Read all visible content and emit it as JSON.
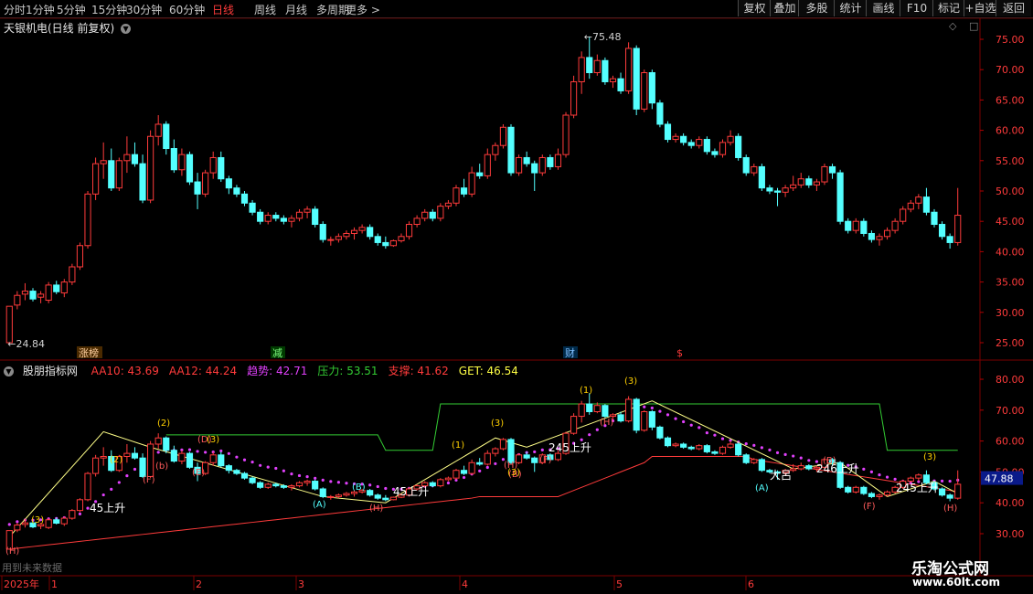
{
  "toolbar": {
    "periods": [
      "分时",
      "1分钟",
      "5分钟",
      "15分钟",
      "30分钟",
      "60分钟",
      "日线",
      "周线",
      "月线",
      "多周期",
      "更多 >"
    ],
    "active_period": "日线",
    "right_buttons": [
      "复权",
      "叠加",
      "多股",
      "统计",
      "画线",
      "F10",
      "标记",
      "+自选",
      "返回"
    ]
  },
  "main_chart": {
    "title": "天银机电(日线 前复权)",
    "high_label": "75.48",
    "low_label": "24.84",
    "price_axis": [
      "75.00",
      "70.00",
      "65.00",
      "60.00",
      "55.00",
      "50.00",
      "45.00",
      "40.00",
      "35.00",
      "30.00",
      "25.00"
    ],
    "event_tags": [
      "涨榜",
      "减",
      "财",
      "$"
    ],
    "candles": [
      [
        25.0,
        31.0,
        24.84,
        31.0
      ],
      [
        31.2,
        33.5,
        30.5,
        32.8
      ],
      [
        33.0,
        34.8,
        32.0,
        33.5
      ],
      [
        33.5,
        34.0,
        31.8,
        32.2
      ],
      [
        32.5,
        33.5,
        31.5,
        33.0
      ],
      [
        32.0,
        35.0,
        31.5,
        34.5
      ],
      [
        34.5,
        35.2,
        33.0,
        33.4
      ],
      [
        33.2,
        35.5,
        32.5,
        35.0
      ],
      [
        35.0,
        38.0,
        34.5,
        37.5
      ],
      [
        37.5,
        41.5,
        37.0,
        41.0
      ],
      [
        41.0,
        50.0,
        40.5,
        49.5
      ],
      [
        49.5,
        55.5,
        48.5,
        54.5
      ],
      [
        54.5,
        58.0,
        52.0,
        55.0
      ],
      [
        55.0,
        57.0,
        50.0,
        50.5
      ],
      [
        50.5,
        55.5,
        50.0,
        55.0
      ],
      [
        55.0,
        59.0,
        53.0,
        56.0
      ],
      [
        56.0,
        58.0,
        54.0,
        54.5
      ],
      [
        54.5,
        56.0,
        48.0,
        48.5
      ],
      [
        48.5,
        60.0,
        48.0,
        59.0
      ],
      [
        59.0,
        62.5,
        57.5,
        61.0
      ],
      [
        61.0,
        61.5,
        56.0,
        57.0
      ],
      [
        57.0,
        58.5,
        53.0,
        53.5
      ],
      [
        53.5,
        57.0,
        52.5,
        56.0
      ],
      [
        56.0,
        56.5,
        51.0,
        51.5
      ],
      [
        51.5,
        53.0,
        47.0,
        49.5
      ],
      [
        49.5,
        53.5,
        49.0,
        53.0
      ],
      [
        53.0,
        56.5,
        52.0,
        55.5
      ],
      [
        55.5,
        56.5,
        51.5,
        52.0
      ],
      [
        52.0,
        52.5,
        49.5,
        50.5
      ],
      [
        50.5,
        51.0,
        49.0,
        49.5
      ],
      [
        49.5,
        50.0,
        47.5,
        48.0
      ],
      [
        48.0,
        48.5,
        46.0,
        46.5
      ],
      [
        46.5,
        47.0,
        44.5,
        45.0
      ],
      [
        45.0,
        46.5,
        44.5,
        46.0
      ],
      [
        46.0,
        46.5,
        45.0,
        45.5
      ],
      [
        45.5,
        46.0,
        44.5,
        45.0
      ],
      [
        45.0,
        46.0,
        44.0,
        45.5
      ],
      [
        45.5,
        47.0,
        45.0,
        46.5
      ],
      [
        46.5,
        47.5,
        45.5,
        47.0
      ],
      [
        47.0,
        47.5,
        44.0,
        44.5
      ],
      [
        44.5,
        45.0,
        41.5,
        42.0
      ],
      [
        42.0,
        42.5,
        41.0,
        42.0
      ],
      [
        42.0,
        43.0,
        41.5,
        42.5
      ],
      [
        42.5,
        43.5,
        42.0,
        43.0
      ],
      [
        43.0,
        44.0,
        42.0,
        43.5
      ],
      [
        43.5,
        44.5,
        43.0,
        44.0
      ],
      [
        44.0,
        44.5,
        42.0,
        42.5
      ],
      [
        42.5,
        43.0,
        41.0,
        41.5
      ],
      [
        41.5,
        42.5,
        40.5,
        41.0
      ],
      [
        41.0,
        42.0,
        40.8,
        41.8
      ],
      [
        41.8,
        43.0,
        41.5,
        42.5
      ],
      [
        42.5,
        45.0,
        42.0,
        44.5
      ],
      [
        44.5,
        46.0,
        44.0,
        45.5
      ],
      [
        45.5,
        47.0,
        45.0,
        46.5
      ],
      [
        46.5,
        47.0,
        45.0,
        45.5
      ],
      [
        45.5,
        48.0,
        45.0,
        47.5
      ],
      [
        47.5,
        48.5,
        47.0,
        48.0
      ],
      [
        48.0,
        51.0,
        47.5,
        50.5
      ],
      [
        50.5,
        52.0,
        49.0,
        49.5
      ],
      [
        49.5,
        54.0,
        49.0,
        53.0
      ],
      [
        53.0,
        54.5,
        52.0,
        52.5
      ],
      [
        52.5,
        57.0,
        52.0,
        56.0
      ],
      [
        56.0,
        58.0,
        55.0,
        57.5
      ],
      [
        57.5,
        61.0,
        57.0,
        60.5
      ],
      [
        60.5,
        61.0,
        52.5,
        53.0
      ],
      [
        53.0,
        56.0,
        52.5,
        55.5
      ],
      [
        55.5,
        56.5,
        54.0,
        54.5
      ],
      [
        54.5,
        55.0,
        50.0,
        53.0
      ],
      [
        53.0,
        56.0,
        52.5,
        55.5
      ],
      [
        55.5,
        56.0,
        53.5,
        54.0
      ],
      [
        54.0,
        57.0,
        53.5,
        56.0
      ],
      [
        56.0,
        63.0,
        55.5,
        62.5
      ],
      [
        62.5,
        69.0,
        62.0,
        68.0
      ],
      [
        68.0,
        73.0,
        66.0,
        72.0
      ],
      [
        72.0,
        75.48,
        68.5,
        69.5
      ],
      [
        69.5,
        72.5,
        69.0,
        71.5
      ],
      [
        71.5,
        72.0,
        67.5,
        68.0
      ],
      [
        68.0,
        69.0,
        67.0,
        68.5
      ],
      [
        68.5,
        69.5,
        66.0,
        66.5
      ],
      [
        66.5,
        74.5,
        66.0,
        73.5
      ],
      [
        73.5,
        74.0,
        62.5,
        63.5
      ],
      [
        63.5,
        70.0,
        63.0,
        69.5
      ],
      [
        69.5,
        70.0,
        63.5,
        64.5
      ],
      [
        64.5,
        65.0,
        60.5,
        61.0
      ],
      [
        61.0,
        61.5,
        58.0,
        58.5
      ],
      [
        58.5,
        59.5,
        58.0,
        59.0
      ],
      [
        59.0,
        59.5,
        57.5,
        58.0
      ],
      [
        58.0,
        58.5,
        57.0,
        57.5
      ],
      [
        57.5,
        59.0,
        57.0,
        58.5
      ],
      [
        58.5,
        59.0,
        56.0,
        56.5
      ],
      [
        56.5,
        57.0,
        55.5,
        56.0
      ],
      [
        56.0,
        58.5,
        55.5,
        58.0
      ],
      [
        58.0,
        60.0,
        57.5,
        59.0
      ],
      [
        59.0,
        59.5,
        55.0,
        55.5
      ],
      [
        55.5,
        56.0,
        52.5,
        53.0
      ],
      [
        53.0,
        54.5,
        52.5,
        54.0
      ],
      [
        54.0,
        54.5,
        50.0,
        50.5
      ],
      [
        50.5,
        51.0,
        49.5,
        50.0
      ],
      [
        50.0,
        50.5,
        47.5,
        49.8
      ],
      [
        49.8,
        51.0,
        49.0,
        50.5
      ],
      [
        50.5,
        52.5,
        50.0,
        51.0
      ],
      [
        51.0,
        53.0,
        50.5,
        52.0
      ],
      [
        52.0,
        52.5,
        50.5,
        51.0
      ],
      [
        51.0,
        52.0,
        50.0,
        51.5
      ],
      [
        51.5,
        54.5,
        51.0,
        54.0
      ],
      [
        54.0,
        54.5,
        52.0,
        53.0
      ],
      [
        53.0,
        53.5,
        44.5,
        45.0
      ],
      [
        45.0,
        45.5,
        43.0,
        43.5
      ],
      [
        43.5,
        45.5,
        43.0,
        45.0
      ],
      [
        45.0,
        45.5,
        42.5,
        43.0
      ],
      [
        43.0,
        43.5,
        41.5,
        42.0
      ],
      [
        42.0,
        43.0,
        41.0,
        42.5
      ],
      [
        42.5,
        44.0,
        42.0,
        43.5
      ],
      [
        43.5,
        45.5,
        43.0,
        45.0
      ],
      [
        45.0,
        47.5,
        44.5,
        47.0
      ],
      [
        47.0,
        48.5,
        46.5,
        48.0
      ],
      [
        48.0,
        49.5,
        47.0,
        49.0
      ],
      [
        49.0,
        50.5,
        46.0,
        46.5
      ],
      [
        46.5,
        47.0,
        44.0,
        44.5
      ],
      [
        44.5,
        45.0,
        42.0,
        42.5
      ],
      [
        42.5,
        43.0,
        40.5,
        41.5
      ],
      [
        41.5,
        50.5,
        41.0,
        46.0
      ]
    ]
  },
  "indicator": {
    "name": "股朋指标网",
    "legend": [
      {
        "label": "AA10: 43.69",
        "color": "#ff3b3b"
      },
      {
        "label": "AA12: 44.24",
        "color": "#ff3b3b"
      },
      {
        "label": "趋势: 42.71",
        "color": "#e040fb"
      },
      {
        "label": "压力: 53.51",
        "color": "#33cc33"
      },
      {
        "label": "支撑: 41.62",
        "color": "#ff3b3b"
      },
      {
        "label": "GET: 46.54",
        "color": "#ffff44"
      }
    ],
    "axis": [
      "80.00",
      "70.00",
      "60.00",
      "50.00",
      "40.00",
      "30.00"
    ],
    "current_value": "47.88",
    "annotations": [
      "45上升",
      "45上升",
      "245上升",
      "大呂",
      "246上升",
      "245上升",
      "(A)",
      "(A)",
      "(B)",
      "(B)",
      "(E)",
      "(F)",
      "(F)",
      "(H)",
      "(H)",
      "(H)",
      "(H)",
      "(H)",
      "(B)",
      "(F)",
      "(D)",
      "(b)",
      "(2)",
      "(1)",
      "(1)",
      "(2)",
      "(3)",
      "(3)",
      "(3)",
      "(3)",
      "(3)",
      "(3)"
    ],
    "footnote": "用到未来数据"
  },
  "time_axis": {
    "labels": [
      "2025年",
      "1",
      "2",
      "3",
      "4",
      "5",
      "6"
    ]
  },
  "watermark": {
    "line1": "乐淘公式网",
    "line2": "www.60lt.com"
  },
  "colors": {
    "up": "#ff3b3b",
    "down": "#54ffff",
    "background": "#000000",
    "grid": "#7a0000",
    "ma_yellow": "#ffff44",
    "trend_magenta": "#e040fb",
    "pressure_green": "#33cc33"
  }
}
